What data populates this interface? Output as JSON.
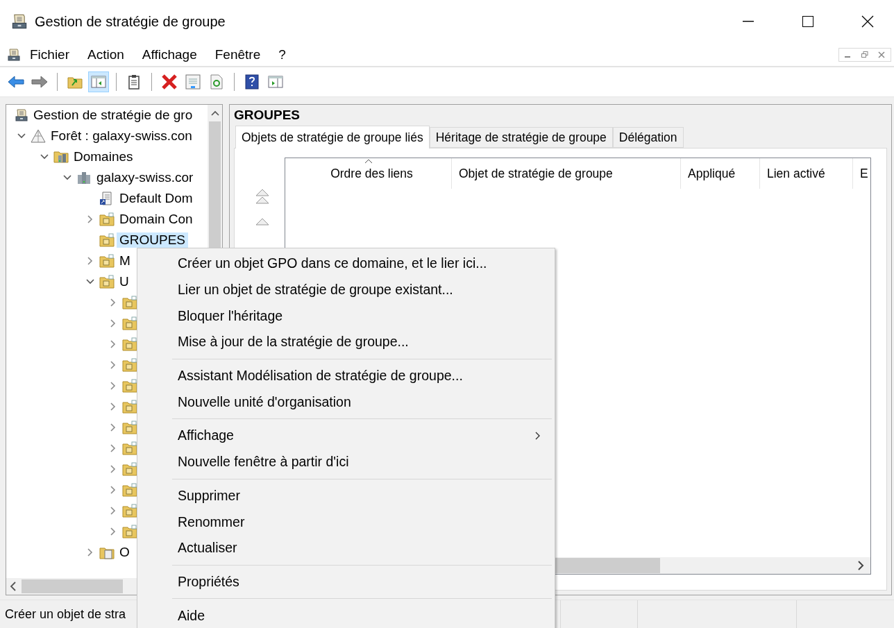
{
  "window": {
    "title": "Gestion de stratégie de groupe"
  },
  "menu_bar": [
    "Fichier",
    "Action",
    "Affichage",
    "Fenêtre",
    "?"
  ],
  "toolbar": [
    {
      "pressed": false
    },
    {
      "pressed": false
    },
    {
      "pressed": false
    },
    {
      "pressed": true
    },
    {
      "pressed": false
    },
    {
      "pressed": false
    },
    {
      "pressed": false
    },
    {
      "pressed": false
    },
    {
      "pressed": false
    },
    {
      "pressed": false
    }
  ],
  "tree": [
    {
      "label": "Gestion de stratégie de gro",
      "kind": "console",
      "selected": false,
      "children": [
        {
          "label": "Forêt : galaxy-swiss.con",
          "kind": "forest",
          "expanded": true,
          "selected": false,
          "children": [
            {
              "label": "Domaines",
              "kind": "domains",
              "expanded": true,
              "selected": false,
              "children": [
                {
                  "label": "galaxy-swiss.cor",
                  "kind": "domain",
                  "expanded": true,
                  "selected": false,
                  "children": [
                    {
                      "label": "Default Dom",
                      "kind": "gpo-link",
                      "selected": false
                    },
                    {
                      "label": "Domain Con",
                      "kind": "ou",
                      "expanded": false,
                      "selected": false
                    },
                    {
                      "label": "GROUPES",
                      "kind": "ou",
                      "selected": true
                    },
                    {
                      "label": "M",
                      "kind": "ou",
                      "expanded": false,
                      "selected": false
                    },
                    {
                      "label": "U",
                      "kind": "ou",
                      "expanded": true,
                      "selected": false,
                      "children": [
                        {
                          "kind": "ou",
                          "expanded": false,
                          "selected": false
                        },
                        {
                          "kind": "ou",
                          "expanded": false,
                          "selected": false
                        },
                        {
                          "kind": "ou",
                          "expanded": false,
                          "selected": false
                        },
                        {
                          "kind": "ou",
                          "expanded": false,
                          "selected": false
                        },
                        {
                          "kind": "ou",
                          "expanded": false,
                          "selected": false
                        },
                        {
                          "kind": "ou",
                          "expanded": false,
                          "selected": false
                        },
                        {
                          "kind": "ou",
                          "expanded": false,
                          "selected": false
                        },
                        {
                          "kind": "ou",
                          "expanded": false,
                          "selected": false
                        },
                        {
                          "kind": "ou",
                          "expanded": false,
                          "selected": false
                        },
                        {
                          "kind": "ou",
                          "expanded": false,
                          "selected": false
                        },
                        {
                          "kind": "ou",
                          "expanded": false,
                          "selected": false
                        },
                        {
                          "kind": "ou",
                          "expanded": false,
                          "selected": false
                        }
                      ]
                    },
                    {
                      "label": "O",
                      "kind": "gpo-folder",
                      "expanded": false,
                      "selected": false
                    }
                  ]
                }
              ]
            }
          ]
        }
      ]
    }
  ],
  "details": {
    "title": "GROUPES",
    "tabs": [
      {
        "label": "Objets de stratégie de groupe liés",
        "selected": true
      },
      {
        "label": "Héritage de stratégie de groupe",
        "selected": false
      },
      {
        "label": "Délégation",
        "selected": false
      }
    ],
    "columns": [
      {
        "label": "Ordre des liens",
        "sorted": true
      },
      {
        "label": "Objet de stratégie de groupe",
        "sorted": false
      },
      {
        "label": "Appliqué",
        "sorted": false
      },
      {
        "label": "Lien activé",
        "sorted": false
      },
      {
        "label": "E",
        "sorted": false
      }
    ]
  },
  "status_bar": {
    "text": "Créer un objet de stra"
  },
  "context_menu": [
    [
      {
        "label": "Créer un objet GPO dans ce domaine, et le lier ici...",
        "submenu": false
      },
      {
        "label": "Lier un objet de stratégie de groupe existant...",
        "submenu": false
      },
      {
        "label": "Bloquer l'héritage",
        "submenu": false
      },
      {
        "label": "Mise à jour de la stratégie de groupe...",
        "submenu": false
      }
    ],
    [
      {
        "label": "Assistant Modélisation de stratégie de groupe...",
        "submenu": false
      },
      {
        "label": "Nouvelle unité d'organisation",
        "submenu": false
      }
    ],
    [
      {
        "label": "Affichage",
        "submenu": true
      },
      {
        "label": "Nouvelle fenêtre à partir d'ici",
        "submenu": false
      }
    ],
    [
      {
        "label": "Supprimer",
        "submenu": false
      },
      {
        "label": "Renommer",
        "submenu": false
      },
      {
        "label": "Actualiser",
        "submenu": false
      }
    ],
    [
      {
        "label": "Propriétés",
        "submenu": false
      }
    ],
    [
      {
        "label": "Aide",
        "submenu": false
      }
    ]
  ]
}
